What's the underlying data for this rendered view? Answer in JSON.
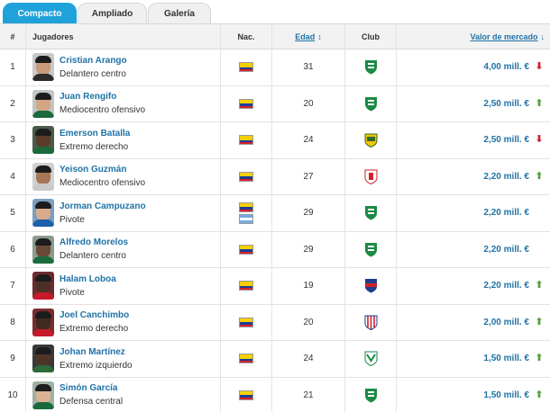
{
  "tabs": [
    {
      "label": "Compacto",
      "active": true
    },
    {
      "label": "Ampliado",
      "active": false
    },
    {
      "label": "Galería",
      "active": false
    }
  ],
  "headers": {
    "num": "#",
    "player": "Jugadores",
    "nat": "Nac.",
    "age": "Edad",
    "club": "Club",
    "value": "Valor de mercado"
  },
  "icons": {
    "age_sort": "sort-updown-icon",
    "value_sort": "sort-down-icon",
    "trend_up": "arrow-up-icon",
    "trend_down": "arrow-down-icon"
  },
  "colors": {
    "accent": "#1fa2d9",
    "link": "#1f72a6",
    "trend_up": "#55a13c",
    "trend_down": "#d0222a"
  },
  "players": [
    {
      "num": "1",
      "name": "Cristian Arango",
      "position": "Delantero centro",
      "nationalities": [
        "Colombia"
      ],
      "age": "31",
      "club": "Atlético Nacional",
      "value": "4,00 mill. €",
      "trend": "down"
    },
    {
      "num": "2",
      "name": "Juan Rengifo",
      "position": "Mediocentro ofensivo",
      "nationalities": [
        "Colombia"
      ],
      "age": "20",
      "club": "Atlético Nacional",
      "value": "2,50 mill. €",
      "trend": "up"
    },
    {
      "num": "3",
      "name": "Emerson Batalla",
      "position": "Extremo derecho",
      "nationalities": [
        "Colombia"
      ],
      "age": "24",
      "club": "Atlético Bucaramanga",
      "value": "2,50 mill. €",
      "trend": "down"
    },
    {
      "num": "4",
      "name": "Yeison Guzmán",
      "position": "Mediocentro ofensivo",
      "nationalities": [
        "Colombia"
      ],
      "age": "27",
      "club": "Independiente Santa Fe",
      "value": "2,20 mill. €",
      "trend": "up"
    },
    {
      "num": "5",
      "name": "Jorman Campuzano",
      "position": "Pivote",
      "nationalities": [
        "Colombia",
        "Argentina"
      ],
      "age": "29",
      "club": "Atlético Nacional",
      "value": "2,20 mill. €",
      "trend": "none"
    },
    {
      "num": "6",
      "name": "Alfredo Morelos",
      "position": "Delantero centro",
      "nationalities": [
        "Colombia"
      ],
      "age": "29",
      "club": "Atlético Nacional",
      "value": "2,20 mill. €",
      "trend": "none"
    },
    {
      "num": "7",
      "name": "Halam Loboa",
      "position": "Pivote",
      "nationalities": [
        "Colombia"
      ],
      "age": "19",
      "club": "Deportivo Independiente Medellín",
      "value": "2,20 mill. €",
      "trend": "up"
    },
    {
      "num": "8",
      "name": "Joel Canchimbo",
      "position": "Extremo derecho",
      "nationalities": [
        "Colombia"
      ],
      "age": "20",
      "club": "Junior FC",
      "value": "2,00 mill. €",
      "trend": "up"
    },
    {
      "num": "9",
      "name": "Johan Martínez",
      "position": "Extremo izquierdo",
      "nationalities": [
        "Colombia"
      ],
      "age": "24",
      "club": "Deportivo Cali",
      "value": "1,50 mill. €",
      "trend": "up"
    },
    {
      "num": "10",
      "name": "Simón García",
      "position": "Defensa central",
      "nationalities": [
        "Colombia"
      ],
      "age": "21",
      "club": "Atlético Nacional",
      "value": "1,50 mill. €",
      "trend": "up"
    }
  ]
}
